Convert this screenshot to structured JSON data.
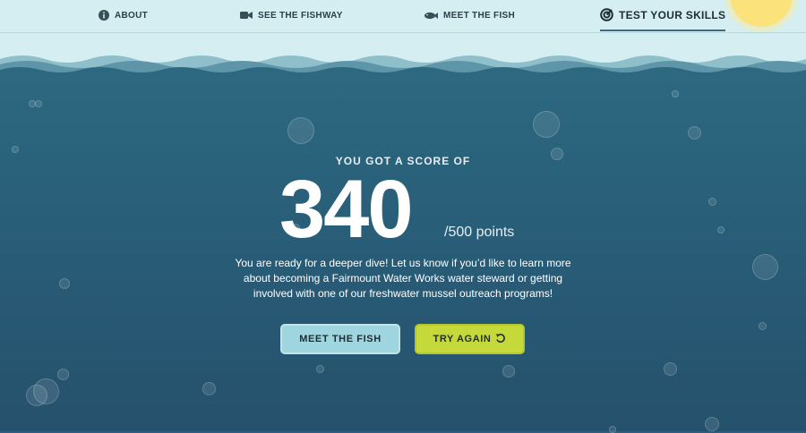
{
  "nav": {
    "items": [
      {
        "label": "ABOUT",
        "icon": "info-icon"
      },
      {
        "label": "SEE THE FISHWAY",
        "icon": "video-camera-icon"
      },
      {
        "label": "MEET THE FISH",
        "icon": "fish-icon"
      },
      {
        "label": "TEST YOUR SKILLS",
        "icon": "target-icon",
        "active": true
      }
    ]
  },
  "result": {
    "intro": "YOU GOT A SCORE OF",
    "score": "340",
    "total": "/500 points",
    "message": "You are ready for a deeper dive! Let us know if you’d like to learn more about becoming a Fairmount Water Works water steward or getting involved with one of our freshwater mussel outreach programs!"
  },
  "actions": {
    "meet_label": "MEET THE FISH",
    "try_label": "TRY AGAIN",
    "try_icon": "retry-icon"
  },
  "colors": {
    "sky": "#d4eef1",
    "water": "#2a5f7b",
    "meet_button": "#9fd5de",
    "try_button": "#c6d93a",
    "sun": "#fbe27b"
  }
}
